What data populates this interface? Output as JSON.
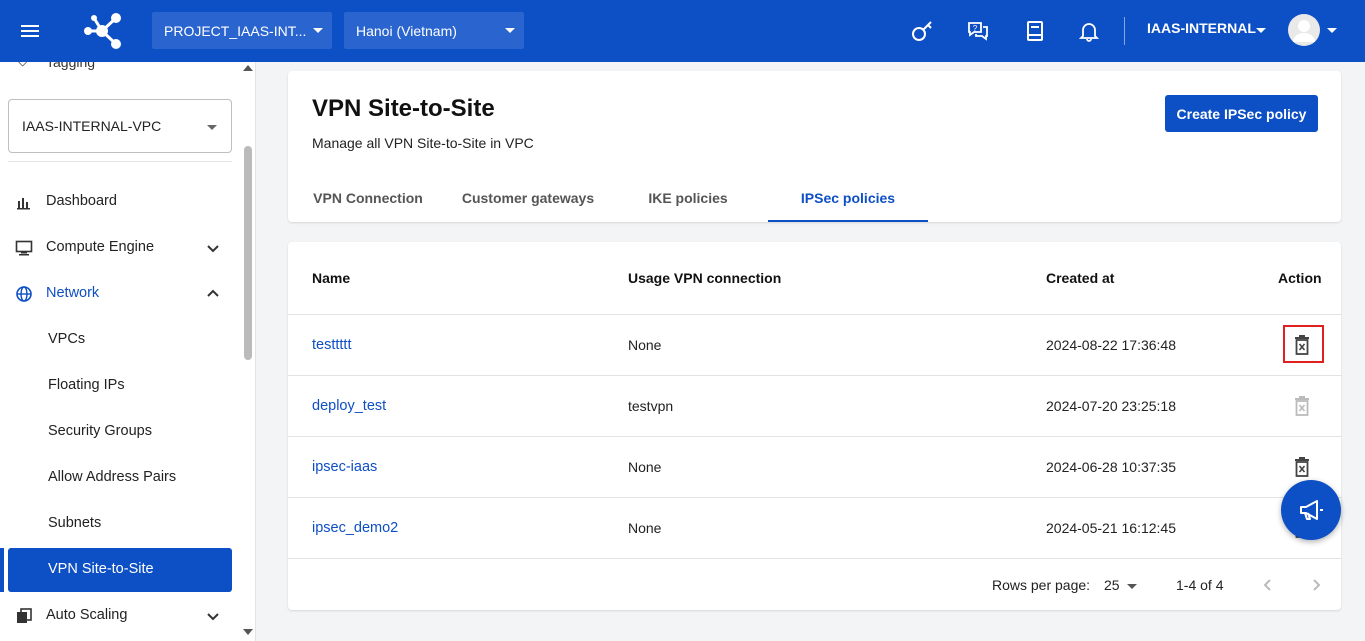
{
  "topbar": {
    "project": "PROJECT_IAAS-INT...",
    "region": "Hanoi (Vietnam)",
    "account": "IAAS-INTERNAL",
    "icons": [
      "menu-icon",
      "network-logo-icon",
      "key-icon",
      "support-chat-icon",
      "docs-icon",
      "bell-icon",
      "user-avatar-icon"
    ]
  },
  "sidebar": {
    "tagging_label": "Tagging",
    "vpc_select": "IAAS-INTERNAL-VPC",
    "items": {
      "dashboard": "Dashboard",
      "compute_engine": "Compute Engine",
      "network": "Network",
      "vpcs": "VPCs",
      "floating_ips": "Floating IPs",
      "security_groups": "Security Groups",
      "allow_address_pairs": "Allow Address Pairs",
      "subnets": "Subnets",
      "vpn_site_to_site": "VPN Site-to-Site",
      "auto_scaling": "Auto Scaling"
    }
  },
  "header": {
    "title": "VPN Site-to-Site",
    "subtitle": "Manage all VPN Site-to-Site in VPC",
    "create_button": "Create IPSec policy",
    "tabs": [
      "VPN Connection",
      "Customer gateways",
      "IKE policies",
      "IPSec policies"
    ],
    "active_tab": "IPSec policies"
  },
  "table": {
    "columns": {
      "name": "Name",
      "usage": "Usage VPN connection",
      "created": "Created at",
      "action": "Action"
    },
    "rows": [
      {
        "name": "testtttt",
        "usage": "None",
        "created": "2024-08-22 17:36:48",
        "delete_enabled": true
      },
      {
        "name": "deploy_test",
        "usage": "testvpn",
        "created": "2024-07-20 23:25:18",
        "delete_enabled": false
      },
      {
        "name": "ipsec-iaas",
        "usage": "None",
        "created": "2024-06-28 10:37:35",
        "delete_enabled": true
      },
      {
        "name": "ipsec_demo2",
        "usage": "None",
        "created": "2024-05-21 16:12:45",
        "delete_enabled": true
      }
    ],
    "footer": {
      "rows_per_page_label": "Rows per page:",
      "rows_per_page": "25",
      "range": "1-4 of 4"
    }
  },
  "colors": {
    "brand": "#0d4fc4",
    "highlight": "#e02020"
  }
}
